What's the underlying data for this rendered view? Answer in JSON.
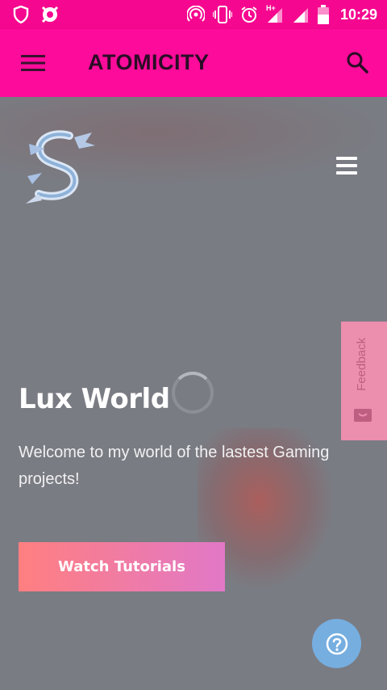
{
  "status_bar": {
    "time": "10:29",
    "network": "H+",
    "icons": [
      "shield-icon",
      "avast-icon",
      "hotspot-icon",
      "vibrate-icon",
      "alarm-icon",
      "signal-icon",
      "signal-icon-2",
      "battery-icon"
    ]
  },
  "app_bar": {
    "title": "ATOMICITY",
    "menu_icon": "hamburger-menu-icon",
    "search_icon": "search-icon",
    "background": "#fd0b9a"
  },
  "hero": {
    "logo": "dragon-logo",
    "nav_icon": "hamburger-icon",
    "title": "Lux World",
    "subtitle": "Welcome to my world of the lastest Gaming projects!",
    "cta_label": "Watch Tutorials",
    "gradient_start": "#ff7f80",
    "gradient_end": "#e178c7"
  },
  "feedback": {
    "label": "Feedback",
    "icon": "feedback-icon",
    "color": "#f38fb1"
  },
  "help": {
    "icon": "question-icon",
    "color": "#76aee0"
  }
}
